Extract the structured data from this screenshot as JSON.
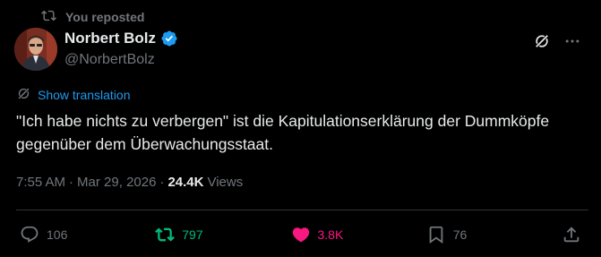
{
  "repost_banner": {
    "text": "You reposted",
    "icon": "repost-icon"
  },
  "author": {
    "display_name": "Norbert Bolz",
    "handle": "@NorbertBolz",
    "verified": true
  },
  "translate_label": "Show translation",
  "tweet": {
    "text": "\"Ich habe nichts zu verbergen\" ist die Kapitulationserklärung der Dummköpfe gegenüber dem Überwachungsstaat."
  },
  "meta": {
    "time": "7:55 AM",
    "separator": "·",
    "date": "Mar 29, 2026",
    "views_count": "24.4K",
    "views_label": "Views"
  },
  "actions": {
    "replies": "106",
    "reposts": "797",
    "likes": "3.8K",
    "bookmarks": "76"
  },
  "colors": {
    "background": "#000000",
    "text": "#e7e9ea",
    "muted": "#71767b",
    "link": "#1d9bf0",
    "repost_green": "#00ba7c",
    "like_pink": "#f91880",
    "verified_blue": "#1d9bf0"
  }
}
